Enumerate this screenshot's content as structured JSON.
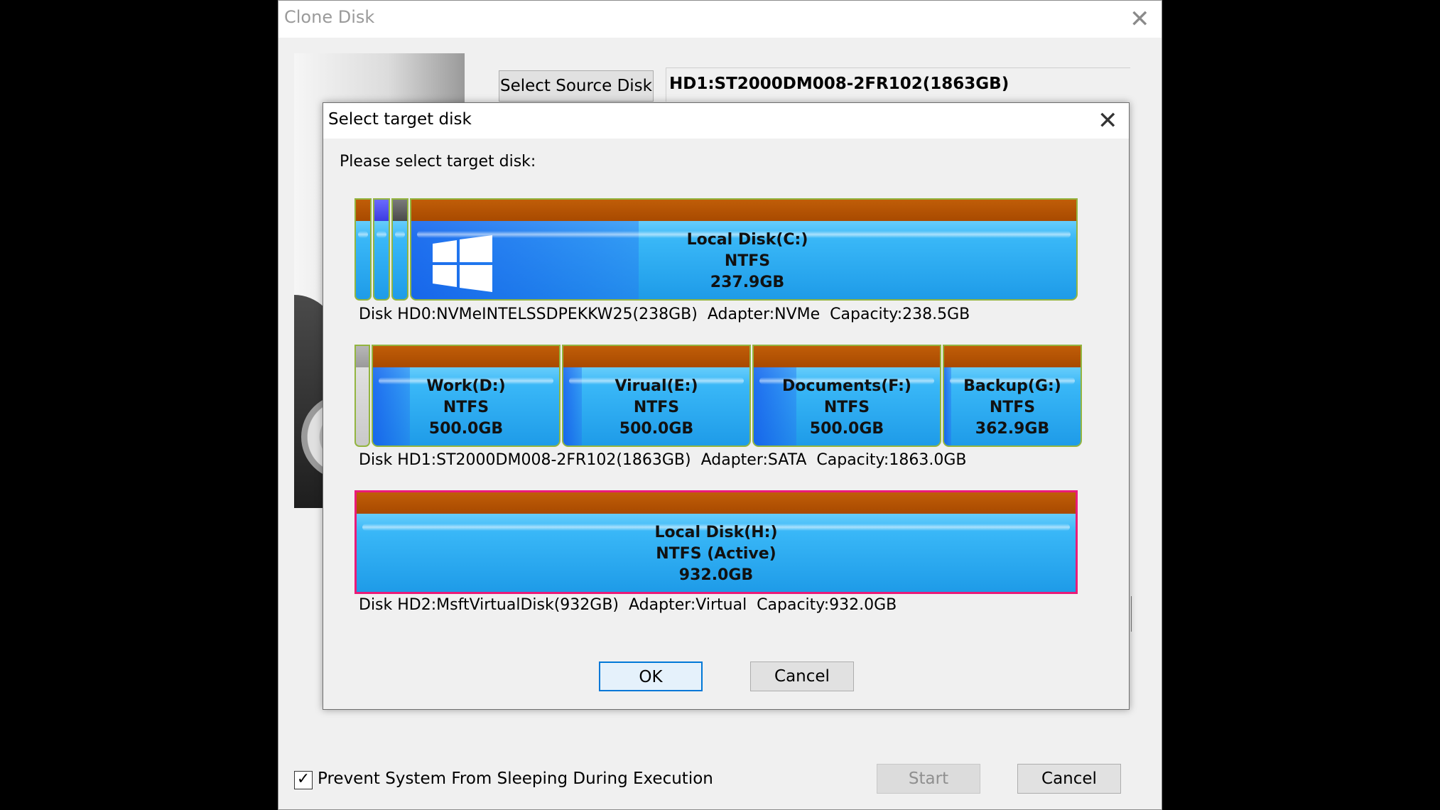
{
  "clone_window": {
    "title": "Clone Disk",
    "select_source_label": "Select Source Disk",
    "source_value": "HD1:ST2000DM008-2FR102(1863GB)",
    "prevent_sleep_label": "Prevent System From Sleeping During Execution",
    "prevent_sleep_checked": true,
    "start_label": "Start",
    "cancel_label": "Cancel"
  },
  "dialog": {
    "title": "Select target disk",
    "prompt": "Please select target disk:",
    "ok_label": "OK",
    "cancel_label": "Cancel",
    "disks": [
      {
        "info": "Disk HD0:NVMeINTELSSDPEKKW25(238GB)  Adapter:NVMe  Capacity:238.5GB",
        "partitions": [
          {
            "name": "Local Disk(C:)",
            "fs": "NTFS",
            "size": "237.9GB"
          }
        ]
      },
      {
        "info": "Disk HD1:ST2000DM008-2FR102(1863GB)  Adapter:SATA  Capacity:1863.0GB",
        "partitions": [
          {
            "name": "Work(D:)",
            "fs": "NTFS",
            "size": "500.0GB"
          },
          {
            "name": "Virual(E:)",
            "fs": "NTFS",
            "size": "500.0GB"
          },
          {
            "name": "Documents(F:)",
            "fs": "NTFS",
            "size": "500.0GB"
          },
          {
            "name": "Backup(G:)",
            "fs": "NTFS",
            "size": "362.9GB"
          }
        ]
      },
      {
        "info": "Disk HD2:MsftVirtualDisk(932GB)  Adapter:Virtual  Capacity:932.0GB",
        "selected": true,
        "partitions": [
          {
            "name": "Local Disk(H:)",
            "fs": "NTFS (Active)",
            "size": "932.0GB"
          }
        ]
      }
    ]
  },
  "icons": {
    "close": "close-icon",
    "check": "checkmark-icon",
    "windows_logo": "windows-logo-icon"
  },
  "colors": {
    "partition_header": "#a84a00",
    "partition_fill": "#39b7f7",
    "selection_outline": "#ea1b78",
    "default_button_border": "#0078d7"
  }
}
